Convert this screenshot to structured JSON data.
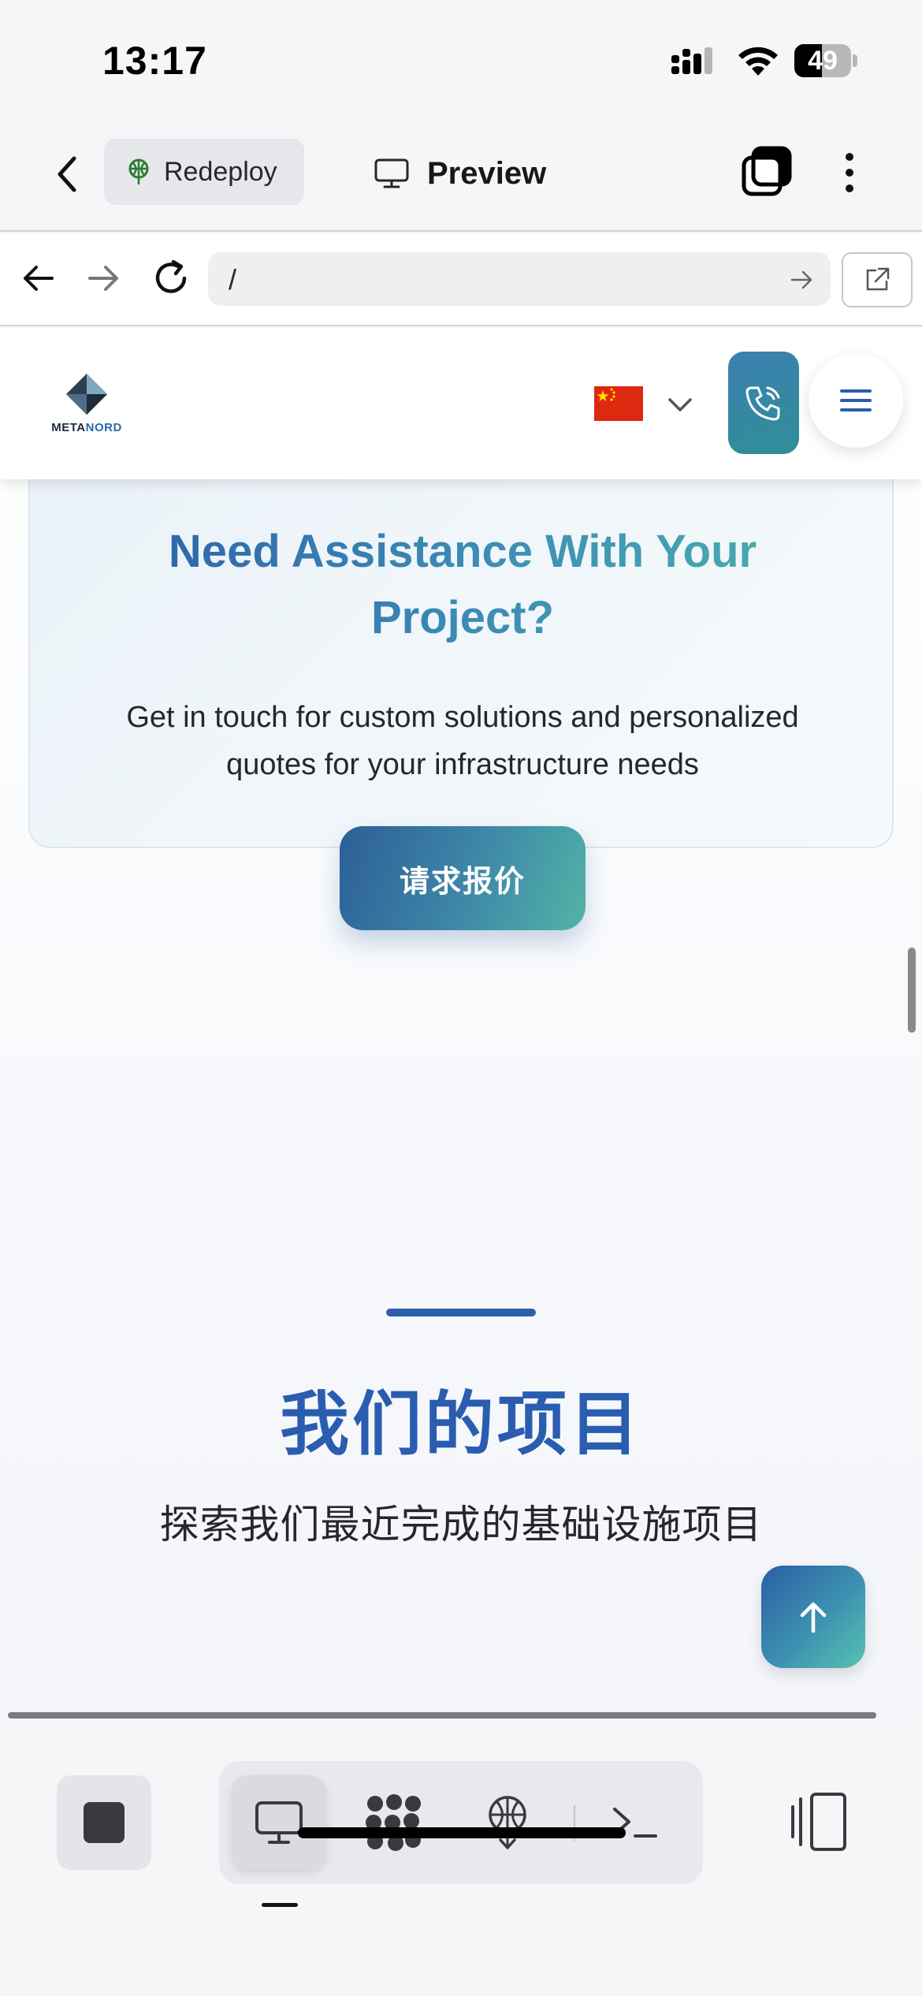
{
  "status_bar": {
    "time": "13:17",
    "battery": "49",
    "battery_level": 0.49,
    "icons": [
      "signal-icon",
      "wifi-icon",
      "battery-icon"
    ]
  },
  "app_header": {
    "back_icon": "chevron-left-icon",
    "redeploy_label": "Redeploy",
    "redeploy_icon": "deploy-icon",
    "preview_label": "Preview",
    "preview_icon": "monitor-icon",
    "tabs_icon": "tabs-icon",
    "more_icon": "more-vertical-icon"
  },
  "browser_bar": {
    "url": "/",
    "icons": [
      "arrow-left-icon",
      "arrow-right-icon",
      "reload-icon",
      "arrow-right-icon",
      "external-link-icon"
    ]
  },
  "site": {
    "logo_text_a": "META",
    "logo_text_b": "NORD",
    "flag_icon": "china-flag-icon",
    "language_icon": "chevron-down-icon",
    "phone_icon": "phone-icon",
    "menu_icon": "hamburger-icon",
    "assistance": {
      "title": "Need Assistance With Your Project?",
      "text": "Get in touch for custom solutions and personalized quotes for your infrastructure needs",
      "button": "请求报价"
    },
    "projects": {
      "title": "我们的项目",
      "subtitle": "探索我们最近完成的基础设施项目"
    },
    "scroll_top_icon": "arrow-up-icon"
  },
  "bottom_toolbar": {
    "stop_icon": "stop-icon",
    "tools": [
      "monitor-icon",
      "apps-grid-icon",
      "deploy-icon",
      "terminal-icon"
    ],
    "split_icon": "split-view-icon"
  },
  "colors": {
    "accent": "#2a5db0",
    "teal": "#48b2ac",
    "flag_red": "#de2910",
    "flag_yellow": "#ffde00"
  }
}
